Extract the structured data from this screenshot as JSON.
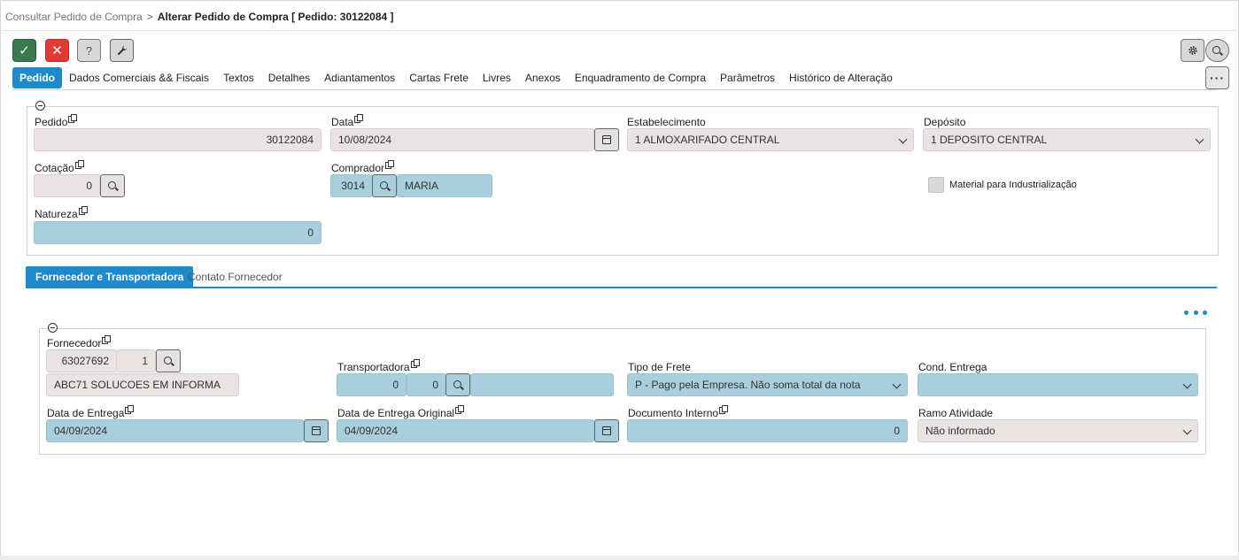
{
  "breadcrumb": {
    "parent": "Consultar Pedido de Compra",
    "separator": ">",
    "current": "Alterar Pedido de Compra [ Pedido: 30122084 ]"
  },
  "toolbar": {
    "confirm_icon": "check-icon",
    "confirm_glyph": "✓",
    "cancel_icon": "close-icon",
    "cancel_glyph": "✕",
    "help_icon": "question-icon",
    "help_glyph": "?",
    "tools_icon": "wrench-icon",
    "tools_glyph": "🔧",
    "gear_icon": "gear-icon",
    "gear_glyph": "⚙",
    "more_glyph": "···"
  },
  "tabs": [
    {
      "label": "Pedido",
      "active": true
    },
    {
      "label": "Dados Comerciais && Fiscais"
    },
    {
      "label": "Textos"
    },
    {
      "label": "Detalhes"
    },
    {
      "label": "Adiantamentos"
    },
    {
      "label": "Cartas Frete"
    },
    {
      "label": "Livres"
    },
    {
      "label": "Anexos"
    },
    {
      "label": "Enquadramento de Compra"
    },
    {
      "label": "Parâmetros"
    },
    {
      "label": "Histórico de Alteração"
    }
  ],
  "pedido_section": {
    "pedido": {
      "label": "Pedido",
      "value": "30122084"
    },
    "data": {
      "label": "Data",
      "value": "10/08/2024"
    },
    "estabelecimento": {
      "label": "Estabelecimento",
      "value": "1 ALMOXARIFADO CENTRAL"
    },
    "deposito": {
      "label": "Depósito",
      "value": "1 DEPOSITO CENTRAL"
    },
    "cotacao": {
      "label": "Cotação",
      "value": "0"
    },
    "comprador": {
      "label": "Comprador",
      "code": "3014",
      "name": "MARIA"
    },
    "material": {
      "label": "Material para Industrialização",
      "checked": false
    },
    "natureza": {
      "label": "Natureza",
      "value": "0"
    }
  },
  "sub_tabs": [
    {
      "label": "Fornecedor e Transportadora",
      "active": true
    },
    {
      "label": "Contato Fornecedor"
    }
  ],
  "fornecedor_section": {
    "fornecedor": {
      "label": "Fornecedor",
      "code": "63027692",
      "seq": "1",
      "name": "ABC71 SOLUCOES EM INFORMA"
    },
    "transportadora": {
      "label": "Transportadora",
      "code": "0",
      "seq": "0",
      "name": ""
    },
    "tipo_frete": {
      "label": "Tipo de Frete",
      "value": "P - Pago pela Empresa. Não soma total da nota"
    },
    "cond_entrega": {
      "label": "Cond. Entrega",
      "value": ""
    },
    "data_entrega": {
      "label": "Data de Entrega",
      "value": "04/09/2024"
    },
    "data_entrega_original": {
      "label": "Data de Entrega Original",
      "value": "04/09/2024"
    },
    "documento_interno": {
      "label": "Documento Interno",
      "value": "0"
    },
    "ramo_atividade": {
      "label": "Ramo Atividade",
      "value": "Não informado"
    }
  },
  "colors": {
    "accent": "#1f8ac9",
    "confirm": "#3a7a4e",
    "cancel": "#e53935",
    "field_gray": "#eae3e3",
    "field_blue": "#a9cfdc"
  }
}
